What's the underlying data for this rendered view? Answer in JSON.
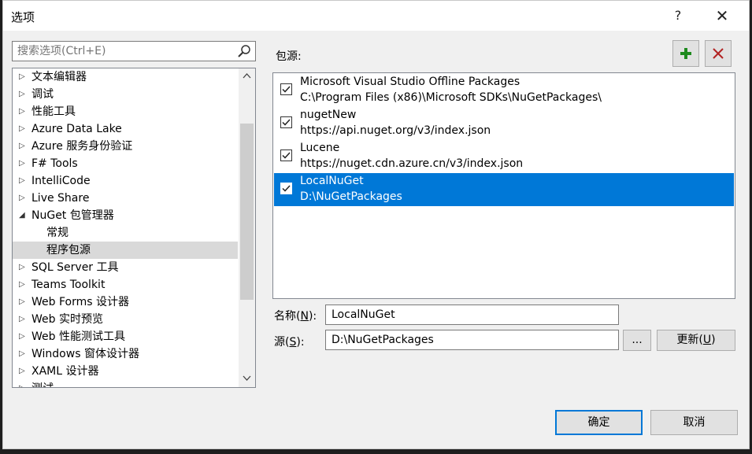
{
  "window": {
    "title": "选项",
    "help_glyph": "?",
    "close_glyph": "✕"
  },
  "search": {
    "placeholder": "搜索选项(Ctrl+E)"
  },
  "tree": {
    "items": [
      {
        "label": "文本编辑器",
        "arrow": "▷"
      },
      {
        "label": "调试",
        "arrow": "▷"
      },
      {
        "label": "性能工具",
        "arrow": "▷"
      },
      {
        "label": "Azure Data Lake",
        "arrow": "▷"
      },
      {
        "label": "Azure 服务身份验证",
        "arrow": "▷"
      },
      {
        "label": "F# Tools",
        "arrow": "▷"
      },
      {
        "label": "IntelliCode",
        "arrow": "▷"
      },
      {
        "label": "Live Share",
        "arrow": "▷"
      },
      {
        "label": "NuGet 包管理器",
        "arrow": "◢"
      },
      {
        "label": "常规",
        "arrow": ""
      },
      {
        "label": "程序包源",
        "arrow": ""
      },
      {
        "label": "SQL Server 工具",
        "arrow": "▷"
      },
      {
        "label": "Teams Toolkit",
        "arrow": "▷"
      },
      {
        "label": "Web Forms 设计器",
        "arrow": "▷"
      },
      {
        "label": "Web 实时预览",
        "arrow": "▷"
      },
      {
        "label": "Web 性能测试工具",
        "arrow": "▷"
      },
      {
        "label": "Windows 窗体设计器",
        "arrow": "▷"
      },
      {
        "label": "XAML 设计器",
        "arrow": "▷"
      },
      {
        "label": "测试",
        "arrow": "▷"
      }
    ]
  },
  "sources": {
    "label": "包源:",
    "items": [
      {
        "name": "Microsoft Visual Studio Offline Packages",
        "url": "C:\\Program Files (x86)\\Microsoft SDKs\\NuGetPackages\\"
      },
      {
        "name": "nugetNew",
        "url": "https://api.nuget.org/v3/index.json"
      },
      {
        "name": "Lucene",
        "url": "https://nuget.cdn.azure.cn/v3/index.json"
      },
      {
        "name": "LocalNuGet",
        "url": "D:\\NuGetPackages"
      }
    ]
  },
  "form": {
    "name_label": "名称(",
    "name_key": "N",
    "name_label_end": "):",
    "name_value": "LocalNuGet",
    "source_label": "源(",
    "source_key": "S",
    "source_label_end": "):",
    "source_value": "D:\\NuGetPackages",
    "browse_label": "...",
    "update_label": "更新(",
    "update_key": "U",
    "update_label_end": ")"
  },
  "footer": {
    "ok_label": "确定",
    "cancel_label": "取消"
  }
}
